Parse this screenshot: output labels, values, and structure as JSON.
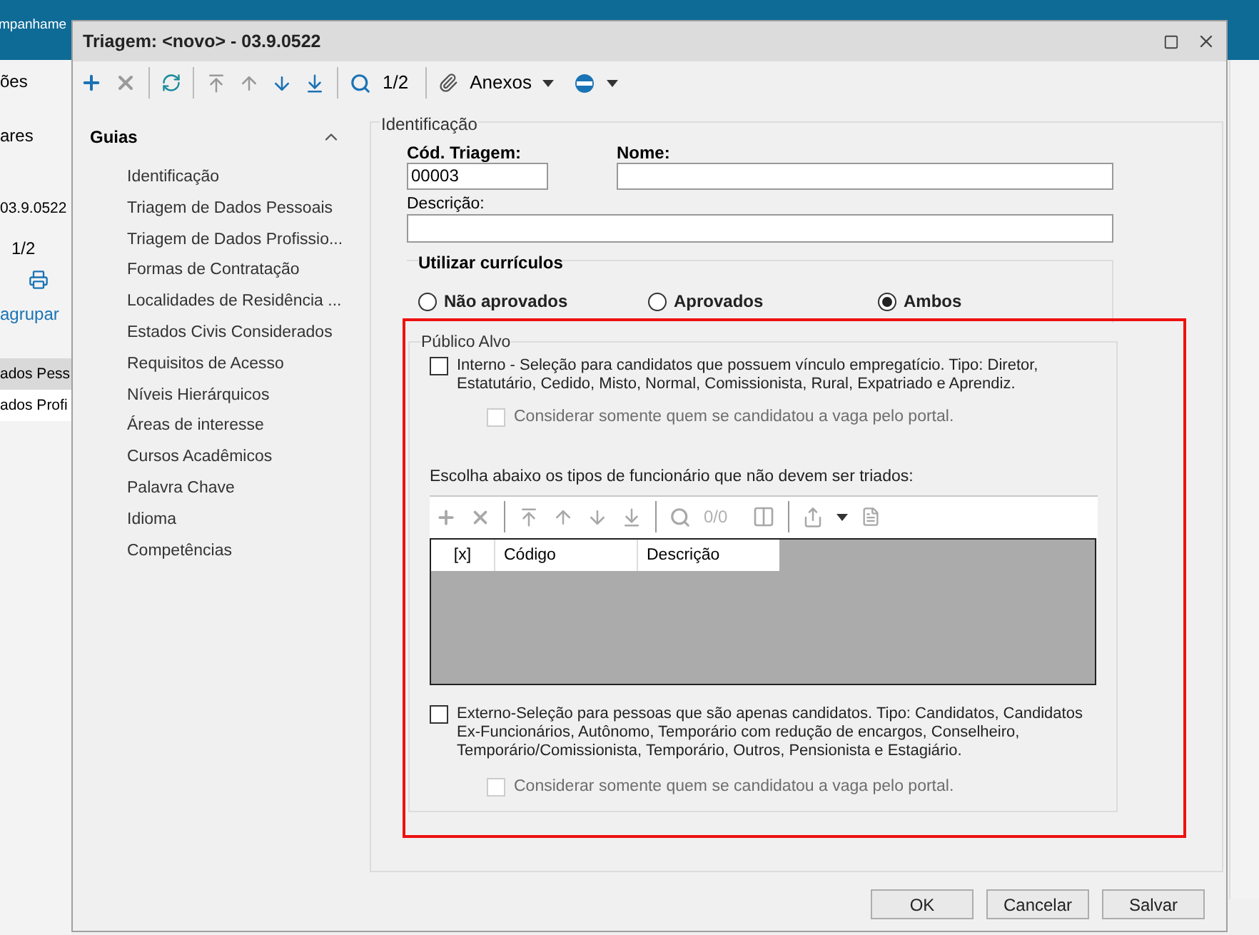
{
  "background_app": {
    "menu_tab": "mpanhame",
    "side_texts": [
      "ões",
      "ares",
      "03.9.0522",
      "1/2",
      "agrupar"
    ],
    "rows": [
      {
        "text": "ados Pess",
        "selected": true
      },
      {
        "text": "ados Profi",
        "selected": false
      }
    ]
  },
  "window": {
    "title": "Triagem: <novo> - 03.9.0522"
  },
  "toolbar": {
    "counter": "1/2",
    "attachments": "Anexos"
  },
  "sidebar": {
    "title": "Guias",
    "expanded": true,
    "items": [
      "Identificação",
      "Triagem de Dados Pessoais",
      "Triagem de Dados Profissio...",
      "Formas de Contratação",
      "Localidades de Residência ...",
      "Estados Civis Considerados",
      "Requisitos de Acesso",
      "Níveis Hierárquicos",
      "Áreas de interesse",
      "Cursos Acadêmicos",
      "Palavra Chave",
      "Idioma",
      "Competências"
    ]
  },
  "identificacao": {
    "legend": "Identificação",
    "code": {
      "label": "Cód. Triagem:",
      "value": "00003"
    },
    "name": {
      "label": "Nome:"
    },
    "description": {
      "label": "Descrição:"
    }
  },
  "curriculos": {
    "title": "Utilizar currículos",
    "options": [
      {
        "label": "Não aprovados",
        "selected": false
      },
      {
        "label": "Aprovados",
        "selected": false
      },
      {
        "label": "Ambos",
        "selected": true
      }
    ]
  },
  "publico_alvo": {
    "legend": "Público Alvo",
    "highlighted": true,
    "interno": {
      "text": "Interno - Seleção para candidatos que possuem vínculo empregatício. Tipo: Diretor, Estatutário, Cedido, Misto, Normal, Comissionista, Rural, Expatriado e Aprendiz.",
      "checked": false
    },
    "interno_portal": {
      "text": "Considerar somente quem se candidatou a vaga pelo portal.",
      "checked": false,
      "disabled": true
    },
    "grid_caption": "Escolha abaixo os tipos de funcionário que não devem ser triados:",
    "grid_counter": "0/0",
    "columns": [
      "[x]",
      "Código",
      "Descrição"
    ],
    "externo": {
      "text": "Externo-Seleção para pessoas que são apenas candidatos. Tipo: Candidatos, Candidatos Ex-Funcionários, Autônomo, Temporário com redução de encargos, Conselheiro, Temporário/Comissionista, Temporário, Outros, Pensionista e Estagiário.",
      "checked": false
    },
    "externo_portal": {
      "text": "Considerar somente quem se candidatou a vaga pelo portal.",
      "checked": false,
      "disabled": true
    }
  },
  "buttons": [
    "OK",
    "Cancelar",
    "Salvar"
  ]
}
